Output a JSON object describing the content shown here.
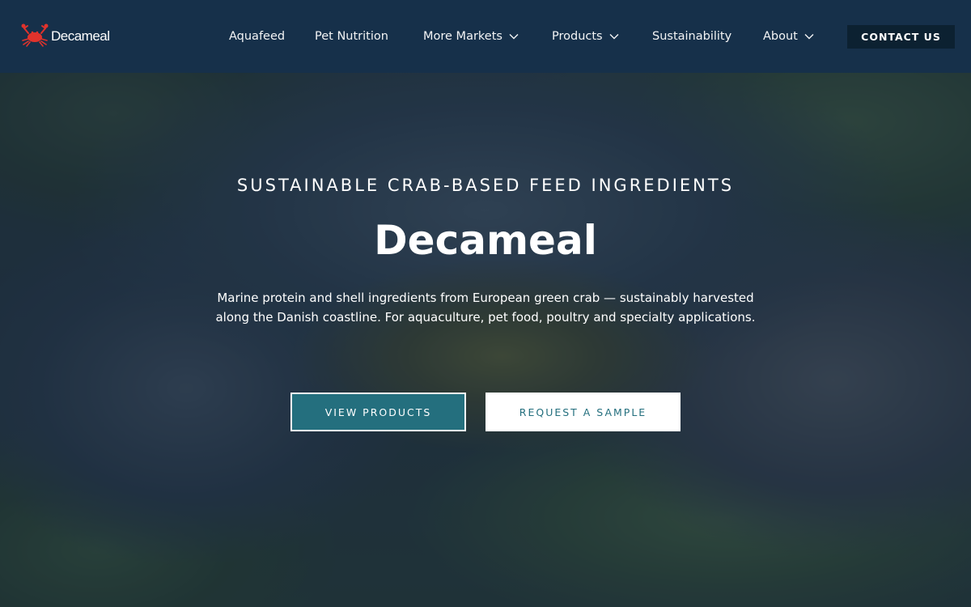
{
  "brand": {
    "name": "Decameal",
    "logo_icon": "crab-icon",
    "logo_color": "#e0332c"
  },
  "nav": {
    "items": [
      {
        "label": "Aquafeed",
        "has_dropdown": false
      },
      {
        "label": "Pet Nutrition",
        "has_dropdown": false
      },
      {
        "label": "More Markets",
        "has_dropdown": true
      },
      {
        "label": "Products",
        "has_dropdown": true
      },
      {
        "label": "Sustainability",
        "has_dropdown": false
      },
      {
        "label": "About",
        "has_dropdown": true
      }
    ],
    "cta_label": "CONTACT US"
  },
  "hero": {
    "kicker": "SUSTAINABLE CRAB-BASED FEED INGREDIENTS",
    "title": "Decameal",
    "description": "Marine protein and shell ingredients from European green crab — sustainably harvested along the Danish coastline. For aquaculture, pet food, poultry and specialty applications.",
    "primary_button": "VIEW PRODUCTS",
    "secondary_button": "REQUEST A SAMPLE"
  },
  "colors": {
    "nav_background": "#16304a",
    "cta_background": "#0c2131",
    "accent_teal": "#246f7e",
    "hero_overlay": "#162a40"
  }
}
